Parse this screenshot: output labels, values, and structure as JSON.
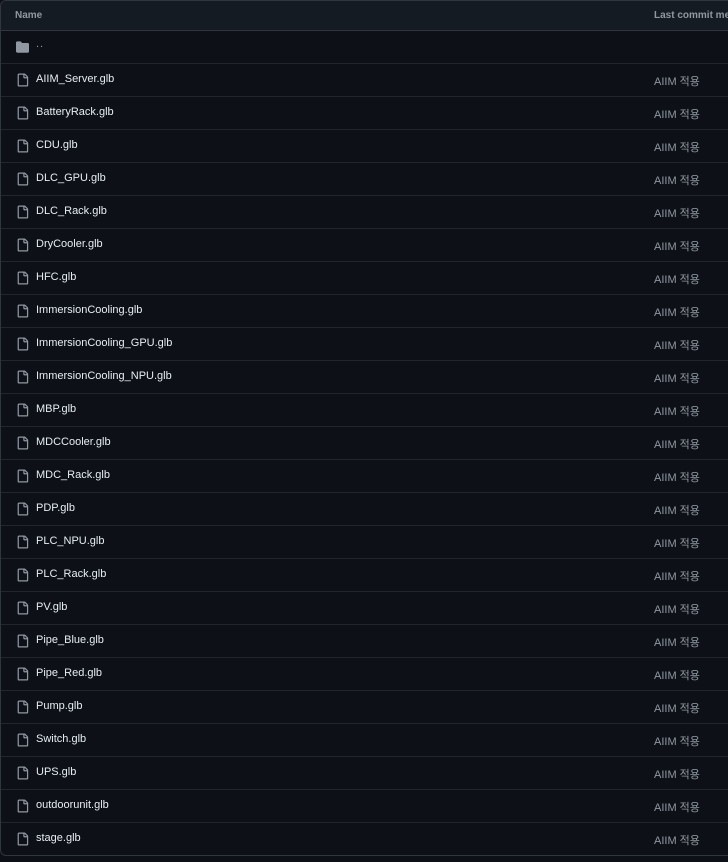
{
  "table": {
    "header": {
      "name": "Name",
      "last_commit": "Last commit message"
    },
    "parent": {
      "label": "..",
      "icon": "folder-icon"
    },
    "files": [
      {
        "name": "AIIM_Server.glb",
        "commit": "AIIM 적용"
      },
      {
        "name": "BatteryRack.glb",
        "commit": "AIIM 적용"
      },
      {
        "name": "CDU.glb",
        "commit": "AIIM 적용"
      },
      {
        "name": "DLC_GPU.glb",
        "commit": "AIIM 적용"
      },
      {
        "name": "DLC_Rack.glb",
        "commit": "AIIM 적용"
      },
      {
        "name": "DryCooler.glb",
        "commit": "AIIM 적용"
      },
      {
        "name": "HFC.glb",
        "commit": "AIIM 적용"
      },
      {
        "name": "ImmersionCooling.glb",
        "commit": "AIIM 적용"
      },
      {
        "name": "ImmersionCooling_GPU.glb",
        "commit": "AIIM 적용"
      },
      {
        "name": "ImmersionCooling_NPU.glb",
        "commit": "AIIM 적용"
      },
      {
        "name": "MBP.glb",
        "commit": "AIIM 적용"
      },
      {
        "name": "MDCCooler.glb",
        "commit": "AIIM 적용"
      },
      {
        "name": "MDC_Rack.glb",
        "commit": "AIIM 적용"
      },
      {
        "name": "PDP.glb",
        "commit": "AIIM 적용"
      },
      {
        "name": "PLC_NPU.glb",
        "commit": "AIIM 적용"
      },
      {
        "name": "PLC_Rack.glb",
        "commit": "AIIM 적용"
      },
      {
        "name": "PV.glb",
        "commit": "AIIM 적용"
      },
      {
        "name": "Pipe_Blue.glb",
        "commit": "AIIM 적용"
      },
      {
        "name": "Pipe_Red.glb",
        "commit": "AIIM 적용"
      },
      {
        "name": "Pump.glb",
        "commit": "AIIM 적용"
      },
      {
        "name": "Switch.glb",
        "commit": "AIIM 적용"
      },
      {
        "name": "UPS.glb",
        "commit": "AIIM 적용"
      },
      {
        "name": "outdoorunit.glb",
        "commit": "AIIM 적용"
      },
      {
        "name": "stage.glb",
        "commit": "AIIM 적용"
      }
    ],
    "file_icon": "file-icon",
    "colors": {
      "background": "#0d1117",
      "header_bg": "#151b23",
      "border": "#30363d",
      "text": "#e6edf3",
      "muted": "#9198a1"
    }
  }
}
